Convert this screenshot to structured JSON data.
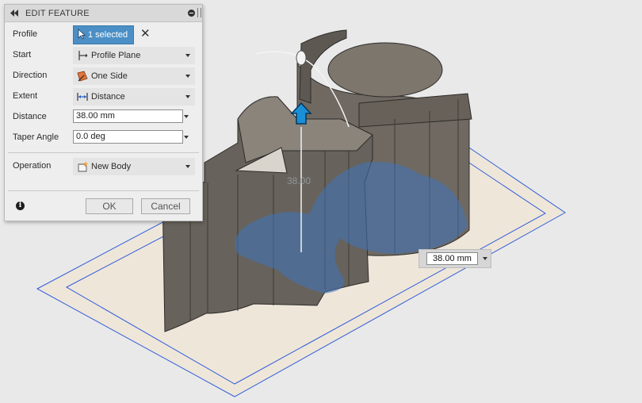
{
  "panel": {
    "title": "EDIT FEATURE",
    "rows": {
      "profile": {
        "label": "Profile",
        "value": "1 selected"
      },
      "start": {
        "label": "Start",
        "value": "Profile Plane",
        "icon": "profile-plane-icon"
      },
      "direction": {
        "label": "Direction",
        "value": "One Side",
        "icon": "one-side-icon"
      },
      "extent": {
        "label": "Extent",
        "value": "Distance",
        "icon": "distance-icon"
      },
      "distance": {
        "label": "Distance",
        "value": "38.00 mm"
      },
      "taper": {
        "label": "Taper Angle",
        "value": "0.0 deg"
      },
      "operation": {
        "label": "Operation",
        "value": "New Body",
        "icon": "new-body-icon"
      }
    },
    "ok_label": "OK",
    "cancel_label": "Cancel"
  },
  "canvas": {
    "distance_input": "38.00 mm",
    "ghost_dimension": "38.00",
    "colors": {
      "background": "#e9e9e9",
      "sketch_plane": "#efe6da",
      "sketch_outline": "#2f5ed9",
      "body": "#6e6860",
      "profile_highlight": "#4b7bb8",
      "manipulator_arrow": "#1a8fd6"
    }
  }
}
